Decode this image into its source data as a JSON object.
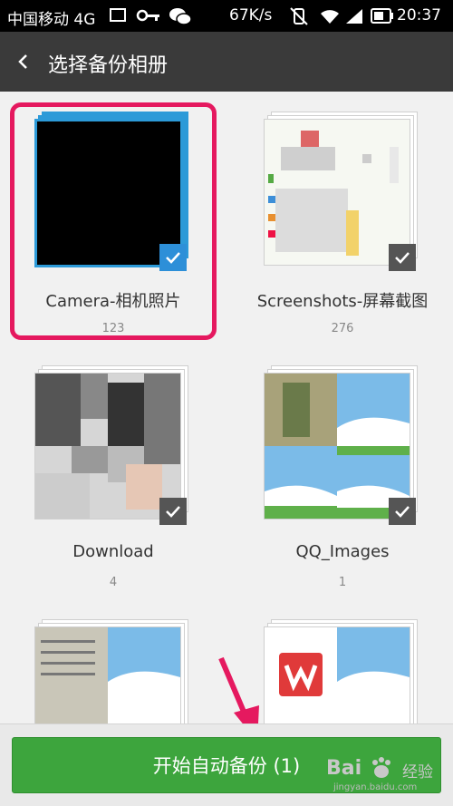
{
  "status_bar": {
    "carrier": "中国移动 4G",
    "speed": "67K/s",
    "time": "20:37"
  },
  "app_bar": {
    "title": "选择备份相册"
  },
  "albums": [
    {
      "name": "Camera-相机照片",
      "count": "123",
      "selected": true
    },
    {
      "name": "Screenshots-屏幕截图",
      "count": "276",
      "selected": false
    },
    {
      "name": "Download",
      "count": "4",
      "selected": false
    },
    {
      "name": "QQ_Images",
      "count": "1",
      "selected": false
    }
  ],
  "bottom": {
    "start_button": "开始自动备份 (1)"
  },
  "watermark": {
    "brand": "Bai",
    "brand_suffix": "经验",
    "url": "jingyan.baidu.com"
  },
  "colors": {
    "accent": "#3da53d",
    "highlight": "#e5195f",
    "check_selected": "#2d8fd8"
  }
}
